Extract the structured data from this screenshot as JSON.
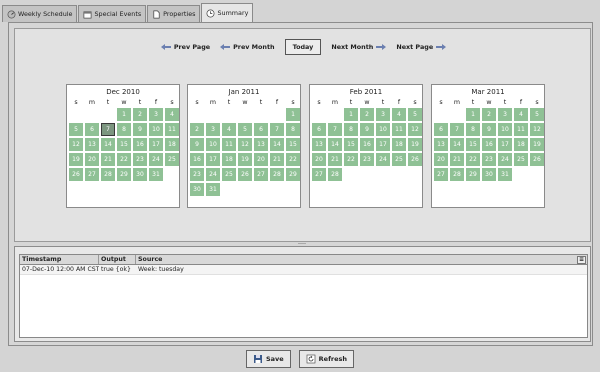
{
  "tabs": [
    {
      "label": "Weekly Schedule",
      "icon": "gauge-icon"
    },
    {
      "label": "Special Events",
      "icon": "calendar-icon"
    },
    {
      "label": "Properties",
      "icon": "document-icon"
    },
    {
      "label": "Summary",
      "icon": "clock-icon",
      "active": true
    }
  ],
  "nav": {
    "prev_page": "Prev Page",
    "prev_month": "Prev Month",
    "today": "Today",
    "next_month": "Next Month",
    "next_page": "Next Page"
  },
  "dow": [
    "s",
    "m",
    "t",
    "w",
    "t",
    "f",
    "s"
  ],
  "months": [
    {
      "title": "Dec 2010",
      "offset": 3,
      "days": 31,
      "selected": 7
    },
    {
      "title": "Jan 2011",
      "offset": 6,
      "days": 31,
      "selected": null
    },
    {
      "title": "Feb 2011",
      "offset": 2,
      "days": 28,
      "selected": null
    },
    {
      "title": "Mar 2011",
      "offset": 2,
      "days": 31,
      "selected": null
    }
  ],
  "table": {
    "columns": [
      "Timestamp",
      "Output",
      "Source"
    ],
    "rows": [
      [
        "07-Dec-10 12:00 AM CST",
        "true {ok}",
        "Week: tuesday"
      ]
    ]
  },
  "buttons": {
    "save": "Save",
    "refresh": "Refresh"
  },
  "colors": {
    "day_cell": "#8fc195",
    "selected_cell": "#7c9680"
  }
}
